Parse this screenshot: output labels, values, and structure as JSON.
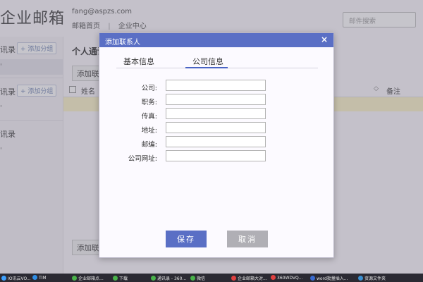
{
  "app": {
    "brand": "企业邮箱",
    "user_email": "fang@aspzs.com",
    "nav": [
      "邮箱首页",
      "企业中心"
    ],
    "nav_sep": "|",
    "search_placeholder": "邮件搜索"
  },
  "sidebar": {
    "groups": [
      {
        "label": "讯录",
        "add": "+ 添加分组"
      },
      {
        "label": "讯录",
        "add": "+ 添加分组"
      },
      {
        "label": "讯录",
        "add": ""
      }
    ]
  },
  "main": {
    "title": "个人通讯",
    "add_button": "添加联",
    "table_headers": {
      "name": "姓名",
      "note": "备注"
    },
    "sort_icon": "◇"
  },
  "dialog": {
    "title": "添加联系人",
    "close": "×",
    "tabs": [
      {
        "label": "基本信息",
        "active": false
      },
      {
        "label": "公司信息",
        "active": true
      }
    ],
    "fields": [
      {
        "label": "公司:",
        "value": ""
      },
      {
        "label": "职务:",
        "value": ""
      },
      {
        "label": "传真:",
        "value": ""
      },
      {
        "label": "地址:",
        "value": ""
      },
      {
        "label": "邮编:",
        "value": ""
      },
      {
        "label": "公司网址:",
        "value": ""
      }
    ],
    "save": "保存",
    "cancel": "取消"
  },
  "taskbar": {
    "items": [
      {
        "label": "IO讯云VO...",
        "color": "#3ea1ff"
      },
      {
        "label": "TIM",
        "color": "#2f8ee6"
      },
      {
        "label": "企业邮箱点...",
        "color": "#49b34a"
      },
      {
        "label": "下载",
        "color": "#49b34a"
      },
      {
        "label": "通讯录 - 360...",
        "color": "#49b34a"
      },
      {
        "label": "微信",
        "color": "#49b34a"
      },
      {
        "label": "企业邮箱大对...",
        "color": "#e04040"
      },
      {
        "label": "360WDVQ...",
        "color": "#e04040"
      },
      {
        "label": "word批量插入...",
        "color": "#3a6bd0"
      },
      {
        "label": "资源文件夹",
        "color": "#3a8fd0"
      }
    ]
  },
  "colors": {
    "accent": "#5a6fc5",
    "cancel": "#b0afb5",
    "highlight_row": "#fbf3c4"
  }
}
